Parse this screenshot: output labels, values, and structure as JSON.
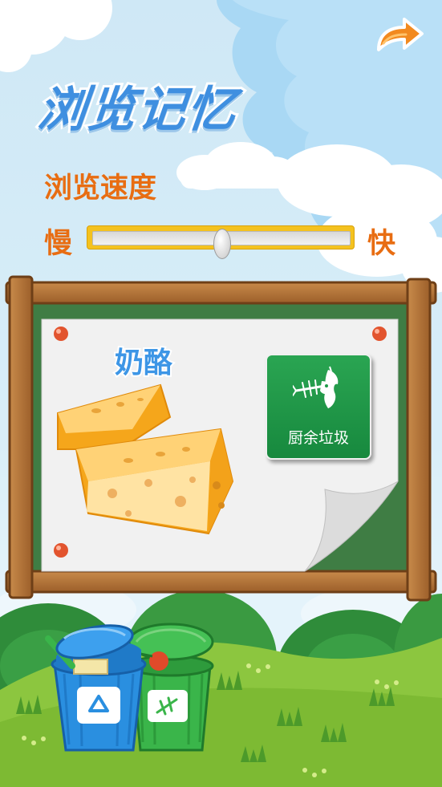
{
  "title": "浏览记忆",
  "speed": {
    "label": "浏览速度",
    "slow_label": "慢",
    "fast_label": "快",
    "value": 0.5
  },
  "card": {
    "item_name": "奶酪",
    "item_image": "cheese-image",
    "category_label": "厨余垃圾",
    "category_icon": "fishbone-apple-core-icon"
  },
  "nav": {
    "back_icon": "curved-arrow-icon"
  },
  "scene": {
    "bins": [
      "recyclable-bin-icon",
      "kitchen-waste-bin-icon"
    ]
  },
  "colors": {
    "title": "#3f8fe0",
    "accent_text": "#e86d12",
    "category_card": "#1e9a48",
    "slider_track": "#f4c21f"
  }
}
